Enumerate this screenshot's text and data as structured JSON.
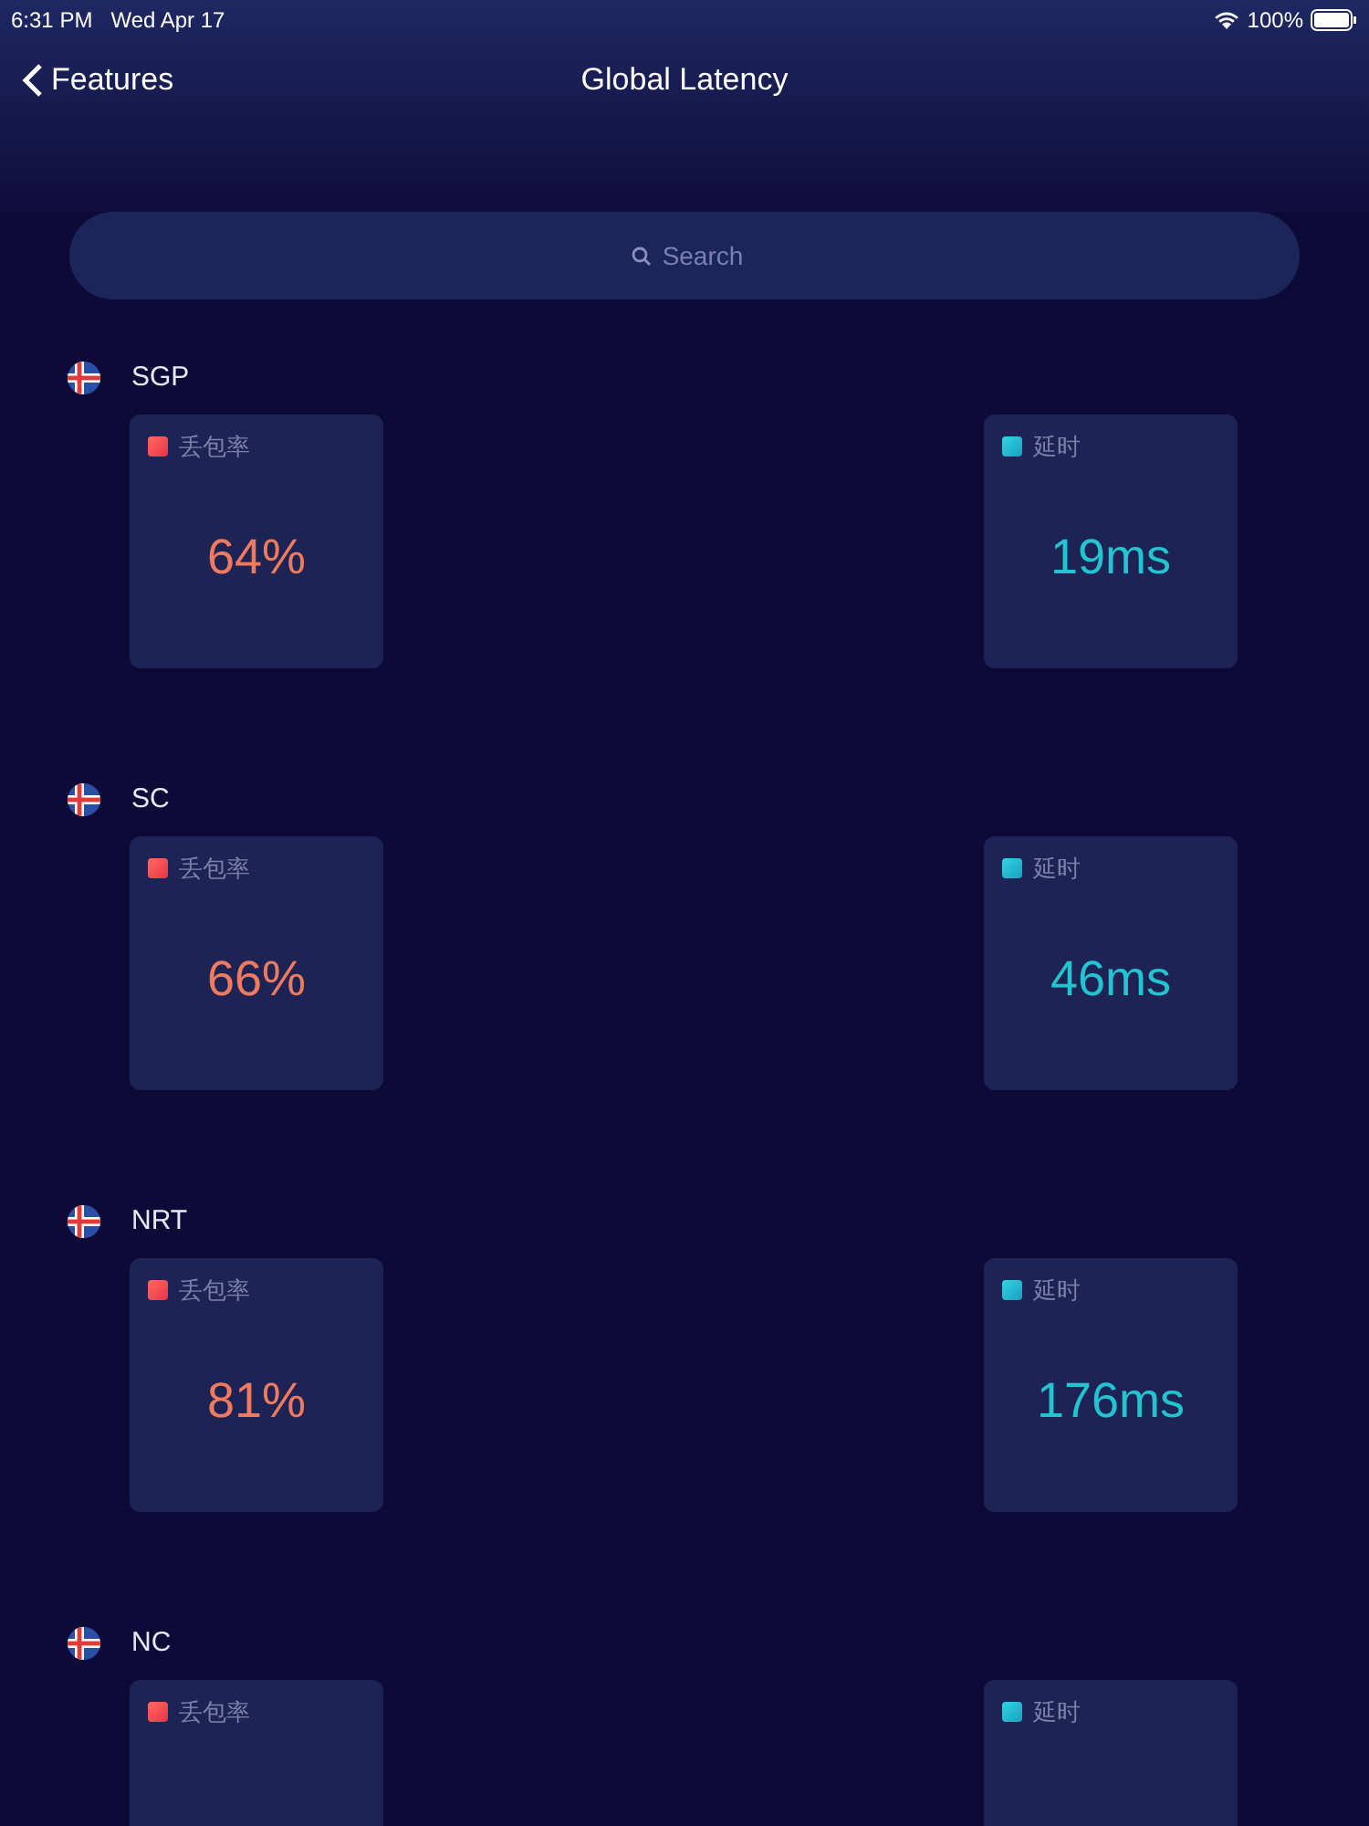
{
  "status_bar": {
    "time": "6:31 PM",
    "date": "Wed Apr 17",
    "battery": "100%"
  },
  "nav": {
    "back": "Features",
    "title": "Global Latency"
  },
  "search": {
    "placeholder": "Search"
  },
  "regions": [
    {
      "name": "SGP",
      "metrics": [
        {
          "kind": "loss",
          "label": "丢包率",
          "value": "64%"
        },
        {
          "kind": "latency",
          "label": "延时",
          "value": "19ms"
        }
      ]
    },
    {
      "name": "SC",
      "metrics": [
        {
          "kind": "loss",
          "label": "丢包率",
          "value": "66%"
        },
        {
          "kind": "latency",
          "label": "延时",
          "value": "46ms"
        }
      ]
    },
    {
      "name": "NRT",
      "metrics": [
        {
          "kind": "loss",
          "label": "丢包率",
          "value": "81%"
        },
        {
          "kind": "latency",
          "label": "延时",
          "value": "176ms"
        }
      ]
    },
    {
      "name": "NC",
      "metrics": [
        {
          "kind": "loss",
          "label": "丢包率"
        },
        {
          "kind": "latency",
          "label": "延时"
        }
      ]
    }
  ]
}
